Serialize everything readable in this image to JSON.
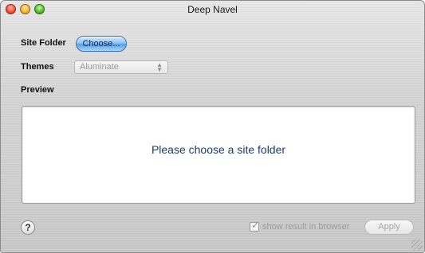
{
  "window": {
    "title": "Deep Navel"
  },
  "form": {
    "site_folder_label": "Site Folder",
    "choose_button_label": "Choose...",
    "themes_label": "Themes",
    "themes_selected": "Aluminate",
    "preview_label": "Preview"
  },
  "preview": {
    "message": "Please choose a site folder"
  },
  "footer": {
    "help_label": "?",
    "show_result_label": "show result in browser",
    "show_result_checked": true,
    "apply_label": "Apply"
  },
  "icons": {
    "close": "close-traffic-light-icon",
    "minimize": "minimize-traffic-light-icon",
    "zoom": "zoom-traffic-light-icon",
    "select_arrows": "select-arrows-icon",
    "resize": "resize-grip-icon"
  },
  "colors": {
    "choose_button_blue": "#5aa1e8",
    "preview_text": "#1d3b6a",
    "disabled_text": "#9b9b9b"
  }
}
